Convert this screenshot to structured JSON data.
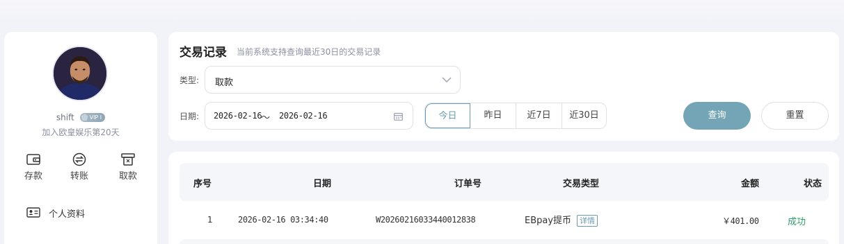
{
  "profile": {
    "username": "shift",
    "vip_label": "VIP I",
    "join_text": "加入欧皇娱乐第20天"
  },
  "quick_actions": [
    {
      "label": "存款",
      "icon": "wallet-icon"
    },
    {
      "label": "转账",
      "icon": "transfer-icon"
    },
    {
      "label": "取款",
      "icon": "withdraw-icon"
    }
  ],
  "menu": [
    {
      "label": "个人资料",
      "icon": "id-card-icon"
    }
  ],
  "filters": {
    "title": "交易记录",
    "subtitle": "当前系统支持查询最近30日的交易记录",
    "type_label": "类型:",
    "type_value": "取款",
    "date_label": "日期:",
    "date_start": "2026-02-16",
    "date_sep": "～",
    "date_end": "2026-02-16",
    "quick_dates": [
      "今日",
      "昨日",
      "近7日",
      "近30日"
    ],
    "active_quick_date": "今日",
    "query_label": "查询",
    "reset_label": "重置",
    "accent_color": "#74a5b6"
  },
  "table": {
    "headers": [
      "序号",
      "日期",
      "订单号",
      "交易类型",
      "金额",
      "状态"
    ],
    "rows": [
      {
        "index": "1",
        "date": "2026-02-16 03:34:40",
        "order_no": "W20260216033440012838",
        "type": "EBpay提币",
        "detail_label": "详情",
        "amount": "￥401.00",
        "status": "成功"
      }
    ],
    "status_success_color": "#2f9e6a"
  }
}
